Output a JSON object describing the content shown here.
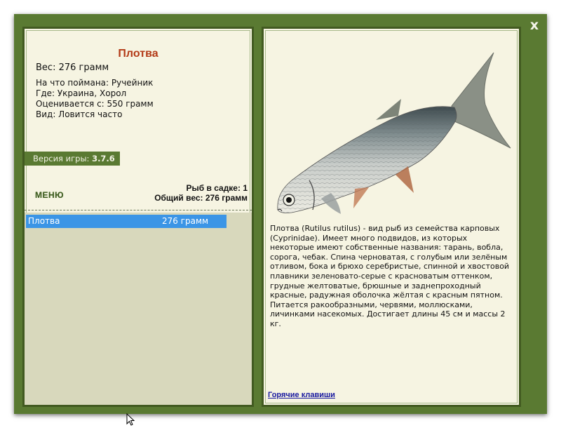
{
  "window": {
    "close_label": "x"
  },
  "fish": {
    "title": "Плотва",
    "weight_label": "Вес: 276 грамм",
    "info": [
      "На что поймана: Ручейник",
      "Где: Украина, Хорол",
      "Оценивается с: 550 грамм",
      "Вид: Ловится часто"
    ],
    "image_icon": "roach-fish-image"
  },
  "version": {
    "label": "Версия игры:",
    "value": "3.7.6"
  },
  "menu": {
    "label": "МЕНЮ"
  },
  "stats": {
    "in_keepnet": "Рыб в садке: 1",
    "total_weight": "Общий вес: 276 грамм"
  },
  "catch_list": [
    {
      "name": "Плотва",
      "weight": "276 грамм"
    }
  ],
  "description": "Плотва (Rutilus rutilus) - вид рыб из семейства карповых (Cyprinidae). Имеет много подвидов, из которых некоторые имеют собственные названия: тарань, вобла, сорога, чебак. Спина черноватая, с голубым или зелёным отливом, бока и брюхо серебристые, спинной и хвостовой плавники зеленовато-серые с красноватым оттенком, грудные желтоватые, брюшные и заднепроходный красные, радужная оболочка жёлтая с красным пятном. Питается ракообразными, червями, моллюсками, личинками насекомых. Достигает длины 45 см и массы 2 кг.",
  "hotkeys_link": "Горячие клавиши",
  "colors": {
    "frame": "#5a7a32",
    "panel": "#f6f4e2",
    "title": "#b33a17",
    "selection": "#3b95e6",
    "list_bg": "#d8d8bc"
  }
}
